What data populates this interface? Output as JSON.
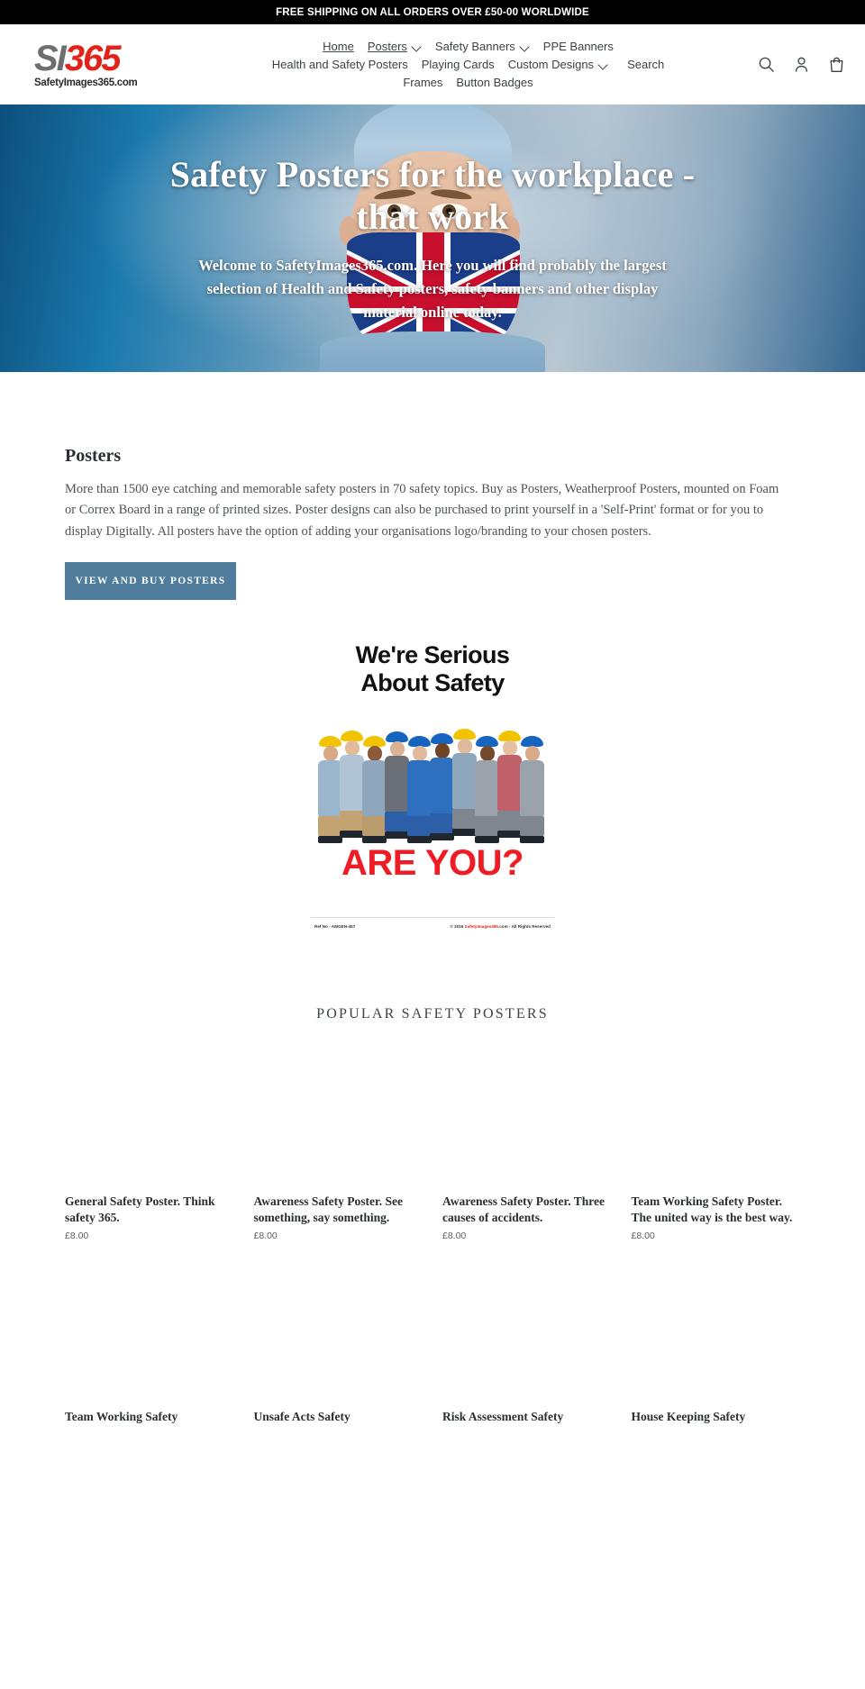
{
  "announcement": {
    "text": "FREE SHIPPING ON ALL ORDERS OVER £50-00 WORLDWIDE"
  },
  "header": {
    "logo": {
      "mark_si": "SI",
      "mark_365": "365",
      "subtext": "SafetyImages365.com"
    },
    "nav_rows": [
      [
        {
          "label": "Home",
          "has_caret": false,
          "underlined": true
        },
        {
          "label": "Posters",
          "has_caret": true,
          "underlined": true
        },
        {
          "label": "Safety Banners",
          "has_caret": true,
          "underlined": false
        },
        {
          "label": "PPE Banners",
          "has_caret": false,
          "underlined": false
        }
      ],
      [
        {
          "label": "Health and Safety Posters",
          "has_caret": false,
          "underlined": false
        },
        {
          "label": "Playing Cards",
          "has_caret": false,
          "underlined": false
        },
        {
          "label": "Custom Designs",
          "has_caret": true,
          "underlined": false
        },
        {
          "label": "Search",
          "has_caret": false,
          "underlined": false
        }
      ],
      [
        {
          "label": "Frames",
          "has_caret": false,
          "underlined": false
        },
        {
          "label": "Button Badges",
          "has_caret": false,
          "underlined": false
        }
      ]
    ],
    "icons": [
      "search-icon",
      "account-icon",
      "cart-icon"
    ]
  },
  "hero": {
    "title": "Safety Posters for the workplace - that work",
    "subtitle": "Welcome to SafetyImages365.com.  Here you will find probably the largest selection of Health and Safety posters, safety banners and other display material online today."
  },
  "posters_section": {
    "heading": "Posters",
    "body": "More than 1500 eye catching and memorable safety posters in 70 safety topics. Buy as Posters, Weatherproof Posters, mounted on Foam or Correx Board in a range of printed sizes. Poster designs can also be purchased to print yourself in a 'Self-Print' format or for you to display Digitally. All posters have the option of adding your organisations logo/branding to your chosen posters.",
    "cta": "VIEW AND BUY POSTERS"
  },
  "feature_poster": {
    "line1": "We're Serious",
    "line2": "About Safety",
    "callout": "ARE YOU?",
    "ref": "Ref No - AWGEN-457",
    "copyright_pre": "© 2016 ",
    "copyright_brand": "SafetyImages365",
    "copyright_post": ".com - All Rights Reserved"
  },
  "popular": {
    "title": "POPULAR SAFETY POSTERS",
    "row1": [
      {
        "title": "General Safety Poster. Think safety 365.",
        "price": "£8.00"
      },
      {
        "title": "Awareness Safety Poster. See something, say something.",
        "price": "£8.00"
      },
      {
        "title": "Awareness Safety Poster. Three causes of accidents.",
        "price": "£8.00"
      },
      {
        "title": "Team Working Safety Poster. The united way is the best way.",
        "price": "£8.00"
      }
    ],
    "row2": [
      {
        "title": "Team Working Safety",
        "price": ""
      },
      {
        "title": "Unsafe Acts Safety",
        "price": ""
      },
      {
        "title": "Risk Assessment Safety",
        "price": ""
      },
      {
        "title": "House Keeping Safety",
        "price": ""
      }
    ]
  },
  "colors": {
    "announce_bg": "#000000",
    "brand_red": "#e2231a",
    "brand_grey": "#6e6e6e",
    "cta_blue": "#4f7d9b",
    "hero_blue": "#1a79ad"
  }
}
